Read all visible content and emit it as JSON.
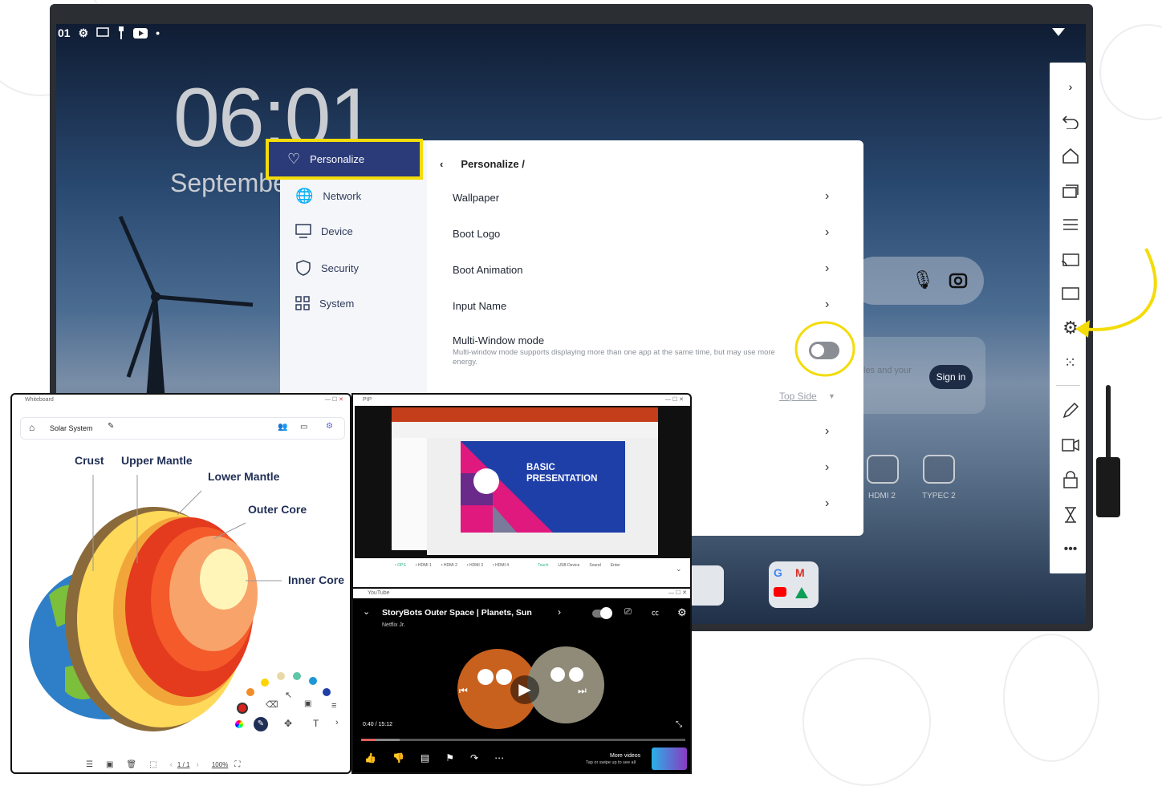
{
  "status_bar": {
    "channel": "01"
  },
  "lockscreen": {
    "time": "06:01",
    "date": "Septembe"
  },
  "card": {
    "text": "les and your",
    "signin": "Sign in"
  },
  "sources": [
    {
      "label": "HDMI 2"
    },
    {
      "label": "TYPEC 2"
    }
  ],
  "settings": {
    "nav": [
      {
        "label": "Personalize"
      },
      {
        "label": "Network"
      },
      {
        "label": "Device"
      },
      {
        "label": "Security"
      },
      {
        "label": "System"
      }
    ],
    "breadcrumb": "Personalize /",
    "rows": [
      {
        "label": "Wallpaper"
      },
      {
        "label": "Boot Logo"
      },
      {
        "label": "Boot Animation"
      },
      {
        "label": "Input Name"
      }
    ],
    "multiwindow": {
      "label": "Multi-Window mode",
      "desc": "Multi-window mode supports displaying more than one app at the same time, but may use more energy.",
      "enabled": false
    },
    "top_side": "Top Side"
  },
  "whiteboard": {
    "window_title": "Whiteboard",
    "doc_title": "Solar System",
    "labels": {
      "crust": "Crust",
      "upper_mantle": "Upper Mantle",
      "lower_mantle": "Lower Mantle",
      "outer_core": "Outer Core",
      "inner_core": "Inner Core"
    },
    "page": "1 / 1",
    "zoom": "100%"
  },
  "pip": {
    "window_title": "PIP",
    "slide_title": "BASIC PRESENTATION",
    "sources": [
      {
        "label": "• OPS"
      },
      {
        "label": "• HDMI 1"
      },
      {
        "label": "• HDMI 2"
      },
      {
        "label": "• HDMI 3"
      },
      {
        "label": "• HDMI 4"
      },
      {
        "label": "Touch"
      },
      {
        "label": "USB Device"
      },
      {
        "label": "Sound"
      },
      {
        "label": "Enter"
      }
    ]
  },
  "youtube": {
    "window_title": "YouTube",
    "video_title": "StoryBots Outer Space | Planets, Sun",
    "channel": "Netflix Jr.",
    "time": "0:40 / 15:12",
    "progress": 0.045,
    "more_videos": "More videos",
    "more_sub": "Tap or swipe up to see all"
  },
  "colors": {
    "accent": "#2b3a78",
    "highlight": "#f3dc09",
    "toggle_off": "#8a8d93"
  }
}
